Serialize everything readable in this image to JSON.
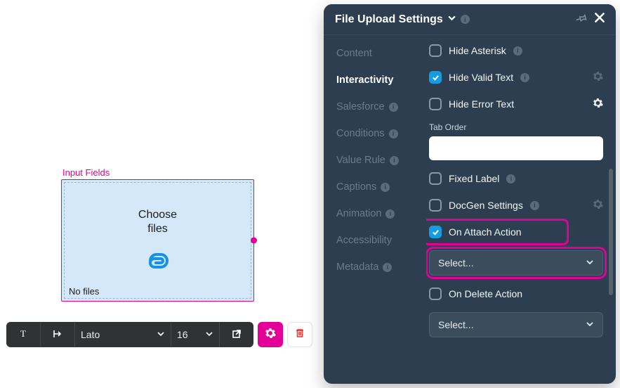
{
  "canvas": {
    "group_label": "Input Fields",
    "file_upload": {
      "choose_line1": "Choose",
      "choose_line2": "files",
      "no_files": "No files"
    }
  },
  "toolbar": {
    "font": "Lato",
    "font_size": "16"
  },
  "panel": {
    "title": "File Upload Settings",
    "tabs": {
      "content": "Content",
      "interactivity": "Interactivity",
      "salesforce": "Salesforce",
      "conditions": "Conditions",
      "value_rule": "Value Rule",
      "captions": "Captions",
      "animation": "Animation",
      "accessibility": "Accessibility",
      "metadata": "Metadata"
    },
    "fields": {
      "hide_asterisk": "Hide Asterisk",
      "hide_valid_text": "Hide Valid Text",
      "hide_error_text": "Hide Error Text",
      "tab_order_label": "Tab Order",
      "tab_order_value": "",
      "fixed_label": "Fixed Label",
      "docgen_settings": "DocGen Settings",
      "on_attach_action": "On Attach Action",
      "on_attach_select": "Select...",
      "on_delete_action": "On Delete Action",
      "on_delete_select": "Select..."
    }
  }
}
